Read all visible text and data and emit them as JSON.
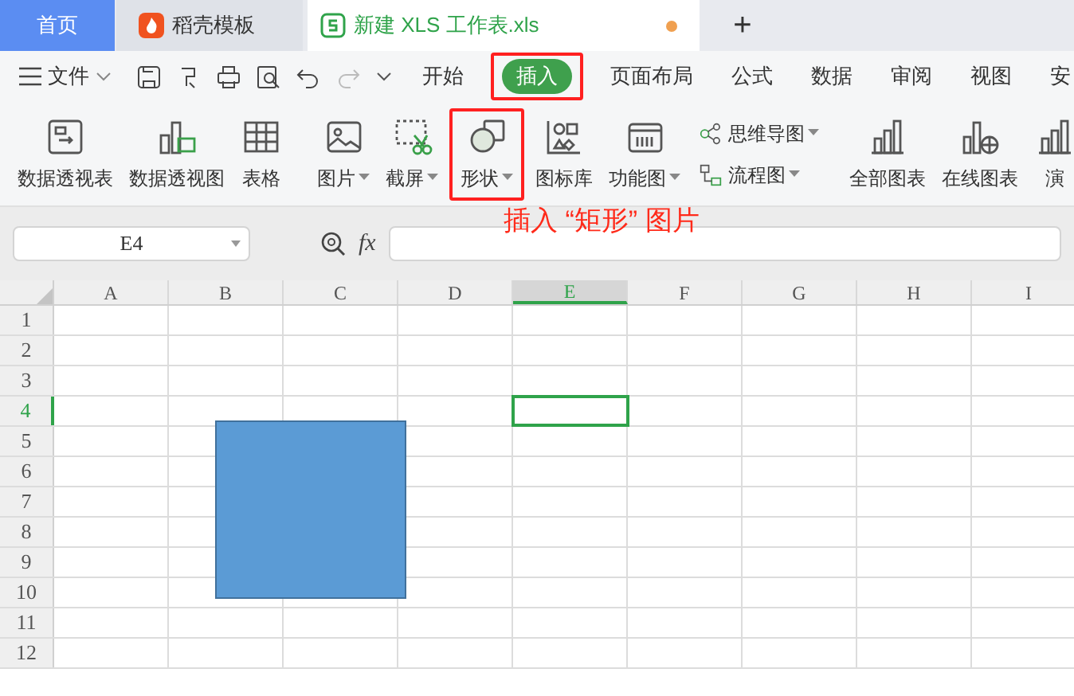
{
  "home_tab": "首页",
  "tabs": [
    {
      "label": "稻壳模板",
      "kind": "docer",
      "selected": false
    },
    {
      "label": "新建 XLS 工作表.xls",
      "kind": "sheet",
      "selected": true,
      "unsaved": true
    }
  ],
  "new_tab": "+",
  "menu": {
    "file": "文件",
    "tabs": [
      {
        "label": "开始",
        "selected": false,
        "highlighted": false
      },
      {
        "label": "插入",
        "selected": true,
        "highlighted": true
      },
      {
        "label": "页面布局",
        "selected": false,
        "highlighted": false
      },
      {
        "label": "公式",
        "selected": false,
        "highlighted": false
      },
      {
        "label": "数据",
        "selected": false,
        "highlighted": false
      },
      {
        "label": "审阅",
        "selected": false,
        "highlighted": false
      },
      {
        "label": "视图",
        "selected": false,
        "highlighted": false
      },
      {
        "label": "安",
        "selected": false,
        "highlighted": false
      }
    ]
  },
  "ribbon": [
    [
      {
        "label": "数据透视表",
        "kind": "pivot",
        "dropdown": false,
        "highlighted": false
      },
      {
        "label": "数据透视图",
        "kind": "pivotchart",
        "dropdown": false,
        "highlighted": false
      },
      {
        "label": "表格",
        "kind": "table",
        "dropdown": false,
        "highlighted": false
      }
    ],
    [
      {
        "label": "图片",
        "kind": "image",
        "dropdown": true,
        "highlighted": false
      },
      {
        "label": "截屏",
        "kind": "screenshot",
        "dropdown": true,
        "highlighted": false
      },
      {
        "label": "形状",
        "kind": "shapes",
        "dropdown": true,
        "highlighted": true
      },
      {
        "label": "图标库",
        "kind": "iconlib",
        "dropdown": false,
        "highlighted": false
      },
      {
        "label": "功能图",
        "kind": "function",
        "dropdown": true,
        "highlighted": false
      },
      {
        "label": "思维导图",
        "kind": "mindmap",
        "dropdown": true,
        "highlighted": false
      },
      {
        "label": "流程图",
        "kind": "flowchart",
        "dropdown": true,
        "highlighted": false
      }
    ],
    [
      {
        "label": "全部图表",
        "kind": "chart",
        "dropdown": false,
        "highlighted": false
      },
      {
        "label": "在线图表",
        "kind": "onlinechart",
        "dropdown": false,
        "highlighted": false
      },
      {
        "label": "演",
        "kind": "chart",
        "dropdown": false,
        "highlighted": false
      }
    ]
  ],
  "annotation": "插入 “矩形” 图片",
  "name_box": "E4",
  "fx": "fx",
  "columns": [
    {
      "label": "A",
      "selected": false
    },
    {
      "label": "B",
      "selected": false
    },
    {
      "label": "C",
      "selected": false
    },
    {
      "label": "D",
      "selected": false
    },
    {
      "label": "E",
      "selected": true
    },
    {
      "label": "F",
      "selected": false
    },
    {
      "label": "G",
      "selected": false
    },
    {
      "label": "H",
      "selected": false
    },
    {
      "label": "I",
      "selected": false
    }
  ],
  "rows": [
    {
      "label": "1",
      "selected": false
    },
    {
      "label": "2",
      "selected": false
    },
    {
      "label": "3",
      "selected": false
    },
    {
      "label": "4",
      "selected": true
    },
    {
      "label": "5",
      "selected": false
    },
    {
      "label": "6",
      "selected": false
    },
    {
      "label": "7",
      "selected": false
    },
    {
      "label": "8",
      "selected": false
    },
    {
      "label": "9",
      "selected": false
    },
    {
      "label": "10",
      "selected": false
    },
    {
      "label": "11",
      "selected": false
    },
    {
      "label": "12",
      "selected": false
    }
  ],
  "shape": {
    "kind": "rectangle",
    "color": "#5b9bd5"
  }
}
